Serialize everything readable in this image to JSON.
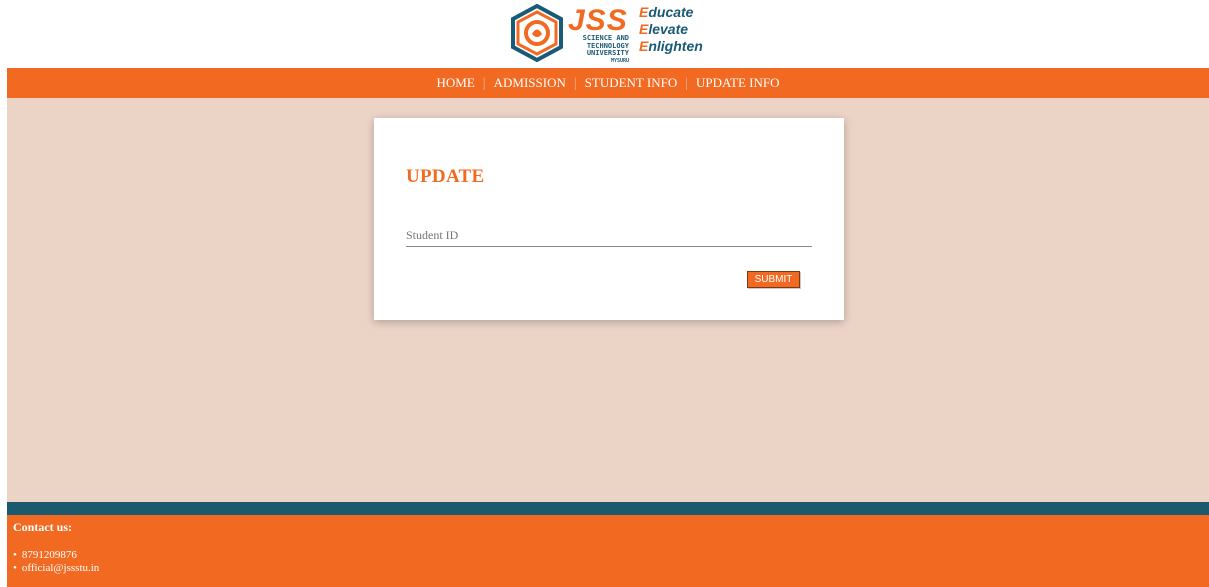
{
  "logo": {
    "brand": "JSS",
    "subtitle_lines": [
      "SCIENCE AND",
      "TECHNOLOGY",
      "UNIVERSITY",
      "MYSURU"
    ],
    "tagline": [
      {
        "first": "E",
        "rest": "ducate"
      },
      {
        "first": "E",
        "rest": "levate"
      },
      {
        "first": "E",
        "rest": "nlighten"
      }
    ]
  },
  "nav": {
    "items": [
      "HOME",
      "ADMISSION",
      "STUDENT INFO",
      "UPDATE INFO"
    ],
    "separator": "|"
  },
  "form": {
    "title": "UPDATE",
    "student_id_placeholder": "Student ID",
    "student_id_value": "",
    "submit_label": "SUBMIT"
  },
  "footer": {
    "contact_title": "Contact us:",
    "phone": "8791209876",
    "email": "official@jssstu.in"
  },
  "colors": {
    "brand_orange": "#f26a22",
    "brand_teal": "#1b5a76",
    "background_peach": "#ebd3c6"
  }
}
